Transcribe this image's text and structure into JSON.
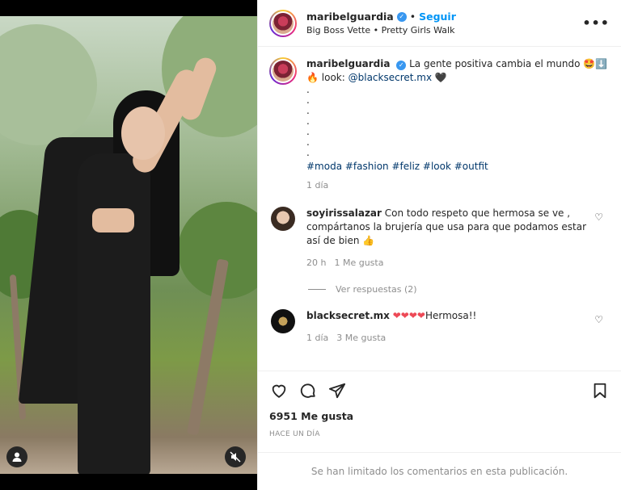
{
  "post": {
    "username": "maribelguardia",
    "verified_symbol": "✓",
    "separator": "•",
    "follow_label": "Seguir",
    "audio": "Big Boss Vette • Pretty Girls Walk",
    "more_symbol": "•••"
  },
  "caption": {
    "username": "maribelguardia",
    "text": "La gente positiva cambia el mundo",
    "emoji_1": "🤩⬇️",
    "fire": "🔥",
    "look_label": "look:",
    "mention": "@blacksecret.mx",
    "heart": "🖤",
    "dots": [
      ".",
      ".",
      ".",
      ".",
      ".",
      ".",
      "."
    ],
    "hashtags": "#moda #fashion #feliz #look #outfit",
    "age": "1 día"
  },
  "comments": [
    {
      "username": "soyirissalazar",
      "text": "Con todo respeto que hermosa se ve , compártanos la brujería que usa para que podamos estar así de bien",
      "emoji": "👍",
      "age": "20 h",
      "likes": "1 Me gusta",
      "heart": "♡"
    },
    {
      "username": "blacksecret.mx",
      "hearts": "❤❤❤❤",
      "text": "Hermosa!!",
      "age": "1 día",
      "likes": "3 Me gusta",
      "heart": "♡"
    }
  ],
  "replies_label": "Ver respuestas (2)",
  "likes_count": "6951 Me gusta",
  "posted_time": "HACE UN DÍA",
  "limited_notice": "Se han limitado los comentarios en esta publicación.",
  "icons": {
    "like": "heart-icon",
    "comment": "comment-icon",
    "share": "share-icon",
    "save": "bookmark-icon",
    "user": "user-tag-icon",
    "mute": "muted-icon"
  },
  "colors": {
    "link": "#0095f6",
    "hashtag": "#00376b",
    "muted": "#8e8e8e",
    "verified": "#3897f0"
  }
}
